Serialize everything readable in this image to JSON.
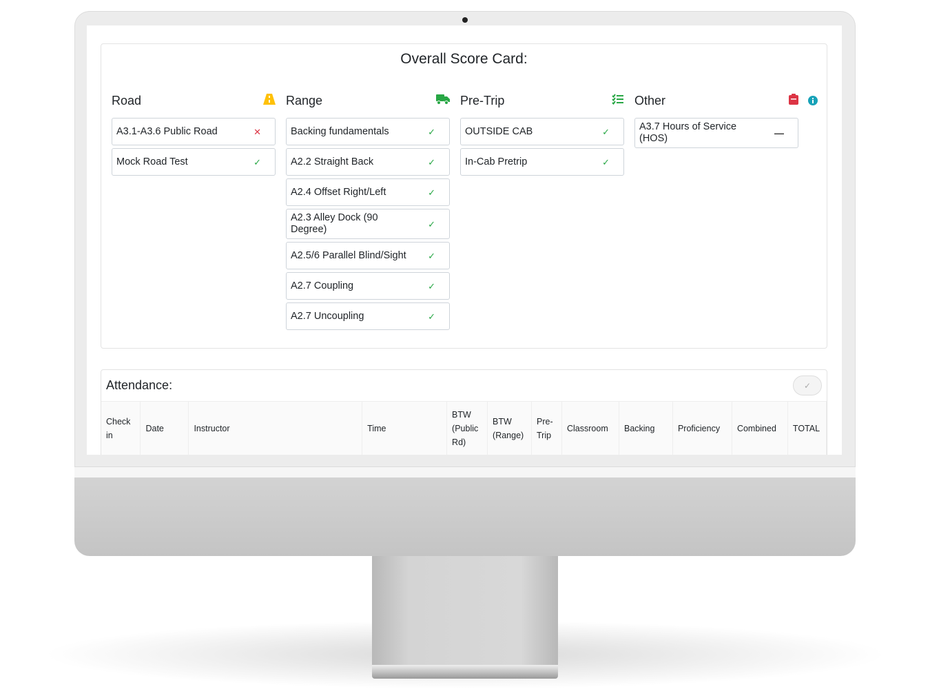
{
  "scorecard": {
    "title": "Overall Score Card:",
    "columns": [
      {
        "label": "Road",
        "icon": "road-icon",
        "icon_color": "#ffc107",
        "items": [
          {
            "label": "A3.1-A3.6 Public Road",
            "status": "fail",
            "mark": "✕"
          },
          {
            "label": "Mock Road Test",
            "status": "pass",
            "mark": "✓"
          }
        ]
      },
      {
        "label": "Range",
        "icon": "truck-icon",
        "icon_color": "#28a745",
        "items": [
          {
            "label": "Backing fundamentals",
            "status": "pass",
            "mark": "✓"
          },
          {
            "label": "A2.2 Straight Back",
            "status": "pass",
            "mark": "✓"
          },
          {
            "label": "A2.4 Offset Right/Left",
            "status": "pass",
            "mark": "✓"
          },
          {
            "label": "A2.3 Alley Dock (90 Degree)",
            "status": "pass",
            "mark": "✓"
          },
          {
            "label": "A2.5/6 Parallel Blind/Sight",
            "status": "pass",
            "mark": "✓"
          },
          {
            "label": "A2.7 Coupling",
            "status": "pass",
            "mark": "✓"
          },
          {
            "label": "A2.7 Uncoupling",
            "status": "pass",
            "mark": "✓"
          }
        ]
      },
      {
        "label": "Pre-Trip",
        "icon": "checklist-icon",
        "icon_color": "#28a745",
        "items": [
          {
            "label": "OUTSIDE CAB",
            "status": "pass",
            "mark": "✓"
          },
          {
            "label": "In-Cab Pretrip",
            "status": "pass",
            "mark": "✓"
          }
        ]
      },
      {
        "label": "Other",
        "icon": "clipboard-icon",
        "icon_color": "#dc3545",
        "items": [
          {
            "label": "A3.7 Hours of Service (HOS)",
            "status": "none",
            "mark": "—"
          }
        ]
      }
    ]
  },
  "attendance": {
    "title": "Attendance:",
    "columns": [
      "Check in",
      "Date",
      "Instructor",
      "Time",
      "BTW (Public Rd)",
      "BTW (Range)",
      "Pre-Trip",
      "Classroom",
      "Backing",
      "Proficiency",
      "Combined",
      "TOTAL"
    ]
  }
}
